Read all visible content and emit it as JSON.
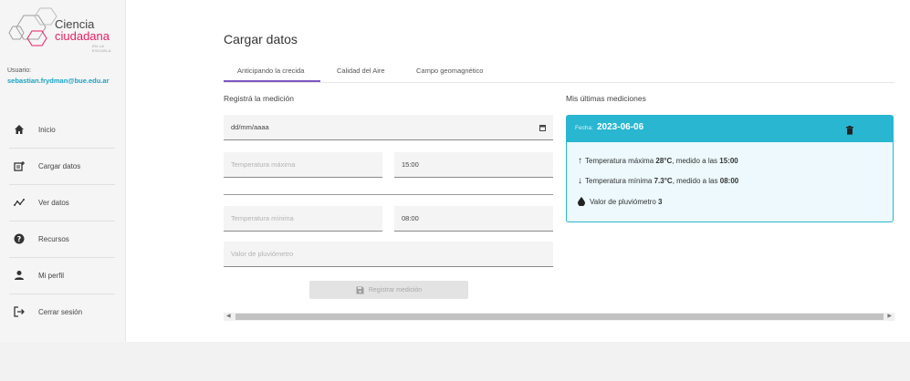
{
  "sidebar": {
    "logo": {
      "line1": "Ciencia",
      "line2": "ciudadana",
      "tagline": "EN LA ESCUELA"
    },
    "user_label": "Usuario:",
    "user_email": "sebastian.frydman@bue.edu.ar",
    "items": [
      {
        "label": "Inicio",
        "icon": "home-icon"
      },
      {
        "label": "Cargar datos",
        "icon": "upload-data-icon"
      },
      {
        "label": "Ver datos",
        "icon": "chart-icon"
      },
      {
        "label": "Recursos",
        "icon": "help-icon"
      },
      {
        "label": "Mi perfil",
        "icon": "person-icon"
      },
      {
        "label": "Cerrar sesión",
        "icon": "logout-icon"
      }
    ]
  },
  "main": {
    "title": "Cargar datos",
    "tabs": [
      {
        "label": "Anticipando la crecida",
        "active": true
      },
      {
        "label": "Calidad del Aire"
      },
      {
        "label": "Campo geomagnético"
      }
    ],
    "form": {
      "heading": "Registrá la medición",
      "date_placeholder": "dd/mm/aaaa",
      "temp_max_placeholder": "Temperatura máxima",
      "temp_max_time": "15:00",
      "temp_min_placeholder": "Temperatura mínima",
      "temp_min_time": "08:00",
      "rain_placeholder": "Valor de pluviómetro",
      "submit_label": "Registrar medición"
    },
    "measurements": {
      "heading": "Mis últimas mediciones",
      "date_label": "Fecha:",
      "date_value": "2023-06-06",
      "max_prefix": "Temperatura máxima",
      "max_value": "28°C",
      "max_mid": ", medido a las",
      "max_time": "15:00",
      "min_prefix": "Temperatura mínima",
      "min_value": "7.3°C",
      "min_mid": ", medido a las",
      "min_time": "08:00",
      "rain_prefix": "Valor de pluviómetro",
      "rain_value": "3"
    }
  },
  "colors": {
    "accent": "#29b6d0",
    "tab_indicator": "#7e57c2",
    "brand_pink": "#e91e63"
  }
}
